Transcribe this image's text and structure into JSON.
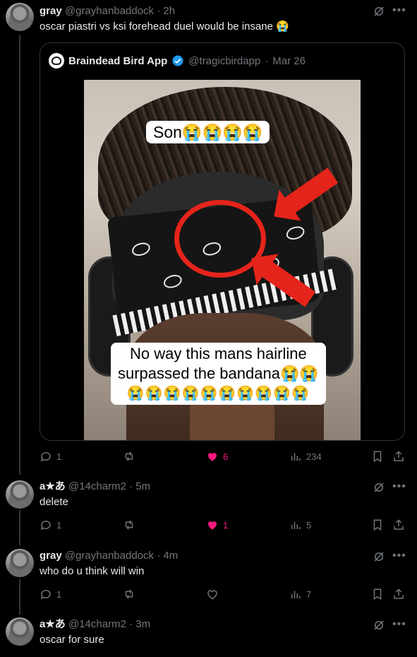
{
  "tweets": [
    {
      "name": "gray",
      "handle": "@grayhanbaddock",
      "time": "2h",
      "text": "oscar piastri vs ksi forehead duel would be insane 😭",
      "stats": {
        "replies": "1",
        "reposts": "",
        "likes": "6",
        "views": "234"
      },
      "liked": true
    },
    {
      "name": "a★あ",
      "handle": "@14charm2",
      "time": "5m",
      "text": "delete",
      "stats": {
        "replies": "1",
        "reposts": "",
        "likes": "1",
        "views": "5"
      },
      "liked": true
    },
    {
      "name": "gray",
      "handle": "@grayhanbaddock",
      "time": "4m",
      "text": "who do u think will win",
      "stats": {
        "replies": "1",
        "reposts": "",
        "likes": "",
        "views": "7"
      },
      "liked": false
    },
    {
      "name": "a★あ",
      "handle": "@14charm2",
      "time": "3m",
      "text": "oscar for sure"
    }
  ],
  "quote": {
    "name": "Braindead Bird App",
    "handle": "@tragicbirdapp",
    "time": "Mar 26",
    "verified_color": "#1d9bf0",
    "caption_top": "Son😭😭😭😭",
    "caption_bottom_line1": "No way this mans hairline",
    "caption_bottom_line2": "surpassed the bandana😭😭",
    "caption_bottom_line3": "😭😭😭😭😭😭😭😭😭😭"
  },
  "separator": "·",
  "icons": {
    "grok": "grok-icon",
    "more": "more-icon",
    "reply": "reply-icon",
    "repost": "repost-icon",
    "like": "heart-icon",
    "views": "views-icon",
    "bookmark": "bookmark-icon",
    "share": "share-icon"
  },
  "colors": {
    "like_active": "#f91880",
    "muted": "#71767b",
    "background": "#000000",
    "verified": "#1d9bf0"
  }
}
